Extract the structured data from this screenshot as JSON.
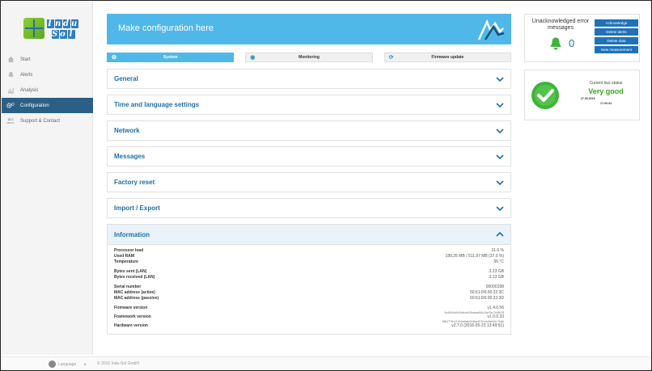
{
  "sidebar": {
    "logo_top": "Indu",
    "logo_bottom": "Sol",
    "items": [
      {
        "label": "Start",
        "icon": "home-icon"
      },
      {
        "label": "Alerts",
        "icon": "bell-icon"
      },
      {
        "label": "Analysis",
        "icon": "bar-chart-icon"
      },
      {
        "label": "Configuration",
        "icon": "gears-icon",
        "active": true
      },
      {
        "label": "Support & Contact",
        "icon": "people-icon"
      }
    ]
  },
  "footer": {
    "language_label": "Language",
    "copyright": "© 2016 Indu-Sol GmbH"
  },
  "banner": {
    "title": "Make configuration here"
  },
  "tabs": [
    {
      "label": "System",
      "icon": "gears-icon",
      "active": true
    },
    {
      "label": "Monitoring",
      "icon": "eye-icon",
      "active": false
    },
    {
      "label": "Firmware update",
      "icon": "refresh-icon",
      "active": false
    }
  ],
  "sections": [
    {
      "title": "General"
    },
    {
      "title": "Time and language settings"
    },
    {
      "title": "Network"
    },
    {
      "title": "Messages"
    },
    {
      "title": "Factory reset"
    },
    {
      "title": "Import / Export"
    }
  ],
  "information": {
    "title": "Information",
    "rows": [
      {
        "key": "Processor load",
        "value": "31.6 %"
      },
      {
        "key": "Used RAM",
        "value": "189,26 MB / 511,97 MB (37.0 %)"
      },
      {
        "key": "Temperature",
        "value": "56 °C"
      },
      {
        "key": "Bytes sent (LAN)",
        "value": "2.23 GB"
      },
      {
        "key": "Bytes received (LAN)",
        "value": "2.13 GB"
      },
      {
        "key": "Serial number",
        "value": "00000198"
      },
      {
        "key": "MAC address (active)",
        "value": "50:61:D6:00:22:3C"
      },
      {
        "key": "MAC address (passive)",
        "value": "50:61:D6:00:22:3D"
      },
      {
        "key": "Firmware version",
        "value": "v1.4.0.56",
        "sub": "9a450f4d940bfe4e52baaae84c16cf7fe7546b28"
      },
      {
        "key": "Framework version",
        "value": "v1.0.0.33",
        "sub": "88b2778411918dfaab2b8fae87514b9fa09117b8b"
      },
      {
        "key": "Hardware version",
        "value": "v2.7.0 (2016-05-23 13:49:51)"
      }
    ]
  },
  "errors": {
    "title": "Unacknowledged error messages",
    "count": "0",
    "buttons": [
      "Acknowledge",
      "Delete alerts",
      "Delete data",
      "New measurement"
    ]
  },
  "bus": {
    "label": "Current bus status",
    "status": "Very good",
    "date": "27.05.2016",
    "time": "17:00:34"
  },
  "colors": {
    "accent": "#4fb8e8",
    "nav_active": "#2b5f86",
    "button": "#1f72b8",
    "good": "#3aa821"
  }
}
